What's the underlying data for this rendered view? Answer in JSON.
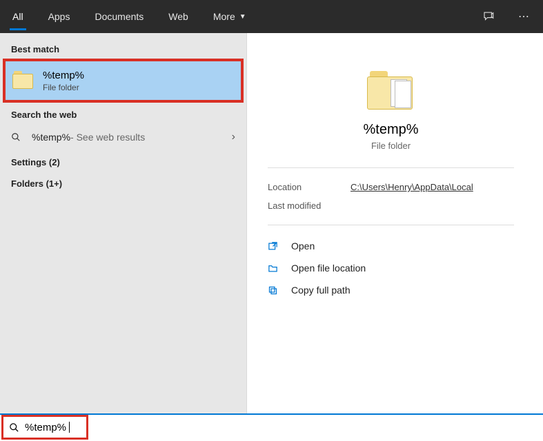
{
  "tabs": {
    "all": "All",
    "apps": "Apps",
    "documents": "Documents",
    "web": "Web",
    "more": "More"
  },
  "left": {
    "best_match_label": "Best match",
    "best_match": {
      "title": "%temp%",
      "subtitle": "File folder"
    },
    "search_web_label": "Search the web",
    "web_result": {
      "prefix": "%temp%",
      "suffix": " - See web results"
    },
    "settings_label": "Settings (2)",
    "folders_label": "Folders (1+)"
  },
  "detail": {
    "title": "%temp%",
    "subtitle": "File folder",
    "location_label": "Location",
    "location_value": "C:\\Users\\Henry\\AppData\\Local",
    "last_modified_label": "Last modified",
    "last_modified_value": "",
    "actions": {
      "open": "Open",
      "open_location": "Open file location",
      "copy_path": "Copy full path"
    }
  },
  "search": {
    "query": "%temp%"
  }
}
